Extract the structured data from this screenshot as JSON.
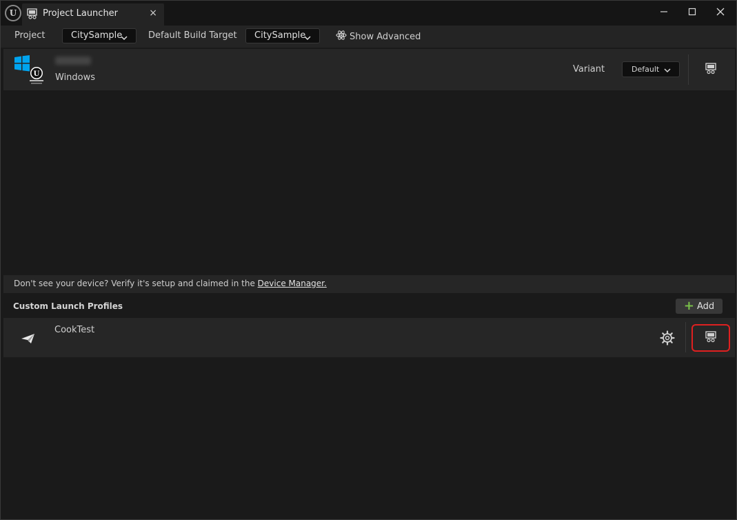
{
  "tab": {
    "title": "Project Launcher",
    "close": "×"
  },
  "window_controls": {
    "minimize": "—",
    "maximize": "☐",
    "close": "✕"
  },
  "toolbar": {
    "project_label": "Project",
    "project_value": "CitySample",
    "build_target_label": "Default Build Target",
    "build_target_value": "CitySample",
    "show_advanced": "Show Advanced"
  },
  "device": {
    "os": "Windows",
    "variant_label": "Variant",
    "variant_value": "Default"
  },
  "hint": {
    "text": "Don't see your device? Verify it's setup and claimed in the ",
    "link": "Device Manager."
  },
  "profiles": {
    "title": "Custom Launch Profiles",
    "add_label": "Add",
    "items": [
      {
        "name": "CookTest"
      }
    ]
  },
  "colors": {
    "accent_add": "#7ac04a",
    "highlight": "#e02020",
    "windows_blue": "#00a4ef"
  }
}
